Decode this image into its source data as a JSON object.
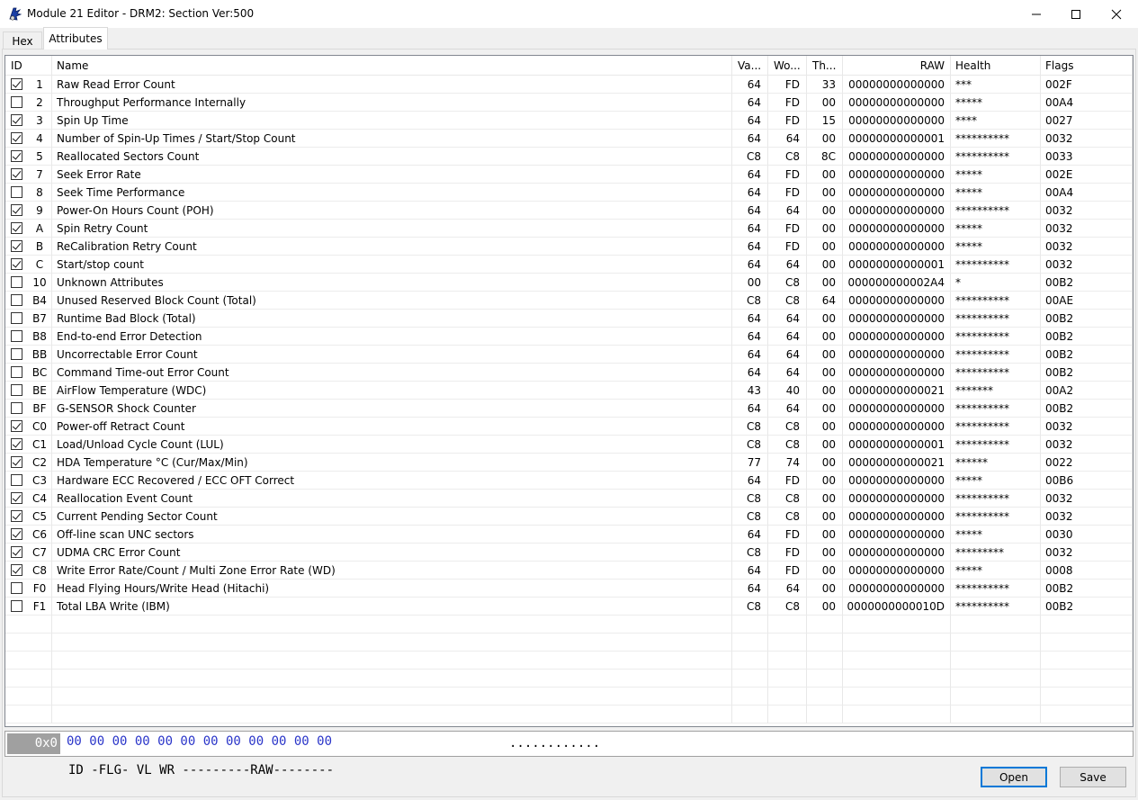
{
  "window": {
    "title": "Module 21 Editor - DRM2: Section Ver:500"
  },
  "tabs": [
    "Hex",
    "Attributes"
  ],
  "columns": {
    "id": "ID",
    "name": "Name",
    "value": "Va...",
    "worst": "Wo...",
    "threshold": "Th...",
    "raw": "RAW",
    "health": "Health",
    "flags": "Flags"
  },
  "rows": [
    {
      "checked": true,
      "id": "1",
      "name": "Raw Read Error Count",
      "va": "64",
      "wo": "FD",
      "th": "33",
      "raw": "00000000000000",
      "health": "***",
      "flags": "002F"
    },
    {
      "checked": false,
      "id": "2",
      "name": "Throughput Performance Internally",
      "va": "64",
      "wo": "FD",
      "th": "00",
      "raw": "00000000000000",
      "health": "*****",
      "flags": "00A4"
    },
    {
      "checked": true,
      "id": "3",
      "name": "Spin Up Time",
      "va": "64",
      "wo": "FD",
      "th": "15",
      "raw": "00000000000000",
      "health": "****",
      "flags": "0027"
    },
    {
      "checked": true,
      "id": "4",
      "name": "Number of Spin-Up Times / Start/Stop Count",
      "va": "64",
      "wo": "64",
      "th": "00",
      "raw": "00000000000001",
      "health": "**********",
      "flags": "0032"
    },
    {
      "checked": true,
      "id": "5",
      "name": "Reallocated Sectors Count",
      "va": "C8",
      "wo": "C8",
      "th": "8C",
      "raw": "00000000000000",
      "health": "**********",
      "flags": "0033"
    },
    {
      "checked": true,
      "id": "7",
      "name": "Seek Error Rate",
      "va": "64",
      "wo": "FD",
      "th": "00",
      "raw": "00000000000000",
      "health": "*****",
      "flags": "002E"
    },
    {
      "checked": false,
      "id": "8",
      "name": "Seek Time Performance",
      "va": "64",
      "wo": "FD",
      "th": "00",
      "raw": "00000000000000",
      "health": "*****",
      "flags": "00A4"
    },
    {
      "checked": true,
      "id": "9",
      "name": "Power-On Hours Count (POH)",
      "va": "64",
      "wo": "64",
      "th": "00",
      "raw": "00000000000000",
      "health": "**********",
      "flags": "0032"
    },
    {
      "checked": true,
      "id": "A",
      "name": "Spin Retry Count",
      "va": "64",
      "wo": "FD",
      "th": "00",
      "raw": "00000000000000",
      "health": "*****",
      "flags": "0032"
    },
    {
      "checked": true,
      "id": "B",
      "name": "ReCalibration Retry Count",
      "va": "64",
      "wo": "FD",
      "th": "00",
      "raw": "00000000000000",
      "health": "*****",
      "flags": "0032"
    },
    {
      "checked": true,
      "id": "C",
      "name": "Start/stop count",
      "va": "64",
      "wo": "64",
      "th": "00",
      "raw": "00000000000001",
      "health": "**********",
      "flags": "0032"
    },
    {
      "checked": false,
      "id": "10",
      "name": "Unknown Attributes",
      "va": "00",
      "wo": "C8",
      "th": "00",
      "raw": "000000000002A4",
      "health": "*",
      "flags": "00B2"
    },
    {
      "checked": false,
      "id": "B4",
      "name": "Unused Reserved Block Count (Total)",
      "va": "C8",
      "wo": "C8",
      "th": "64",
      "raw": "00000000000000",
      "health": "**********",
      "flags": "00AE"
    },
    {
      "checked": false,
      "id": "B7",
      "name": "Runtime Bad Block (Total)",
      "va": "64",
      "wo": "64",
      "th": "00",
      "raw": "00000000000000",
      "health": "**********",
      "flags": "00B2"
    },
    {
      "checked": false,
      "id": "B8",
      "name": "End-to-end Error Detection",
      "va": "64",
      "wo": "64",
      "th": "00",
      "raw": "00000000000000",
      "health": "**********",
      "flags": "00B2"
    },
    {
      "checked": false,
      "id": "BB",
      "name": "Uncorrectable Error Count",
      "va": "64",
      "wo": "64",
      "th": "00",
      "raw": "00000000000000",
      "health": "**********",
      "flags": "00B2"
    },
    {
      "checked": false,
      "id": "BC",
      "name": "Command Time-out Error Count",
      "va": "64",
      "wo": "64",
      "th": "00",
      "raw": "00000000000000",
      "health": "**********",
      "flags": "00B2"
    },
    {
      "checked": false,
      "id": "BE",
      "name": "AirFlow Temperature (WDC)",
      "va": "43",
      "wo": "40",
      "th": "00",
      "raw": "00000000000021",
      "health": "*******",
      "flags": "00A2"
    },
    {
      "checked": false,
      "id": "BF",
      "name": "G-SENSOR Shock Counter",
      "va": "64",
      "wo": "64",
      "th": "00",
      "raw": "00000000000000",
      "health": "**********",
      "flags": "00B2"
    },
    {
      "checked": true,
      "id": "C0",
      "name": "Power-off Retract Count",
      "va": "C8",
      "wo": "C8",
      "th": "00",
      "raw": "00000000000000",
      "health": "**********",
      "flags": "0032"
    },
    {
      "checked": true,
      "id": "C1",
      "name": "Load/Unload Cycle Count (LUL)",
      "va": "C8",
      "wo": "C8",
      "th": "00",
      "raw": "00000000000001",
      "health": "**********",
      "flags": "0032"
    },
    {
      "checked": true,
      "id": "C2",
      "name": "HDA Temperature °C (Cur/Max/Min)",
      "va": "77",
      "wo": "74",
      "th": "00",
      "raw": "00000000000021",
      "health": "******",
      "flags": "0022"
    },
    {
      "checked": false,
      "id": "C3",
      "name": "Hardware ECC Recovered / ECC OFT Correct",
      "va": "64",
      "wo": "FD",
      "th": "00",
      "raw": "00000000000000",
      "health": "*****",
      "flags": "00B6"
    },
    {
      "checked": true,
      "id": "C4",
      "name": "Reallocation Event Count",
      "va": "C8",
      "wo": "C8",
      "th": "00",
      "raw": "00000000000000",
      "health": "**********",
      "flags": "0032"
    },
    {
      "checked": true,
      "id": "C5",
      "name": "Current Pending Sector Count",
      "va": "C8",
      "wo": "C8",
      "th": "00",
      "raw": "00000000000000",
      "health": "**********",
      "flags": "0032"
    },
    {
      "checked": true,
      "id": "C6",
      "name": "Off-line scan UNC sectors",
      "va": "64",
      "wo": "FD",
      "th": "00",
      "raw": "00000000000000",
      "health": "*****",
      "flags": "0030"
    },
    {
      "checked": true,
      "id": "C7",
      "name": "UDMA CRC Error Count",
      "va": "C8",
      "wo": "FD",
      "th": "00",
      "raw": "00000000000000",
      "health": "*********",
      "flags": "0032"
    },
    {
      "checked": true,
      "id": "C8",
      "name": "Write Error Rate/Count / Multi Zone Error Rate (WD)",
      "va": "64",
      "wo": "FD",
      "th": "00",
      "raw": "00000000000000",
      "health": "*****",
      "flags": "0008"
    },
    {
      "checked": false,
      "id": "F0",
      "name": "Head Flying Hours/Write Head (Hitachi)",
      "va": "64",
      "wo": "64",
      "th": "00",
      "raw": "00000000000000",
      "health": "**********",
      "flags": "00B2"
    },
    {
      "checked": false,
      "id": "F1",
      "name": "Total LBA Write (IBM)",
      "va": "C8",
      "wo": "C8",
      "th": "00",
      "raw": "0000000000010D",
      "health": "**********",
      "flags": "00B2"
    }
  ],
  "hex": {
    "offset": "0x0",
    "bytes": "00 00 00 00 00 00 00 00 00 00 00 00",
    "ascii": "............",
    "legend": "ID -FLG- VL WR ---------RAW--------"
  },
  "buttons": {
    "open": "Open",
    "save": "Save"
  },
  "icons": {
    "app": "drive-icon",
    "minimize": "minimize-icon",
    "maximize": "maximize-icon",
    "close": "close-icon"
  }
}
